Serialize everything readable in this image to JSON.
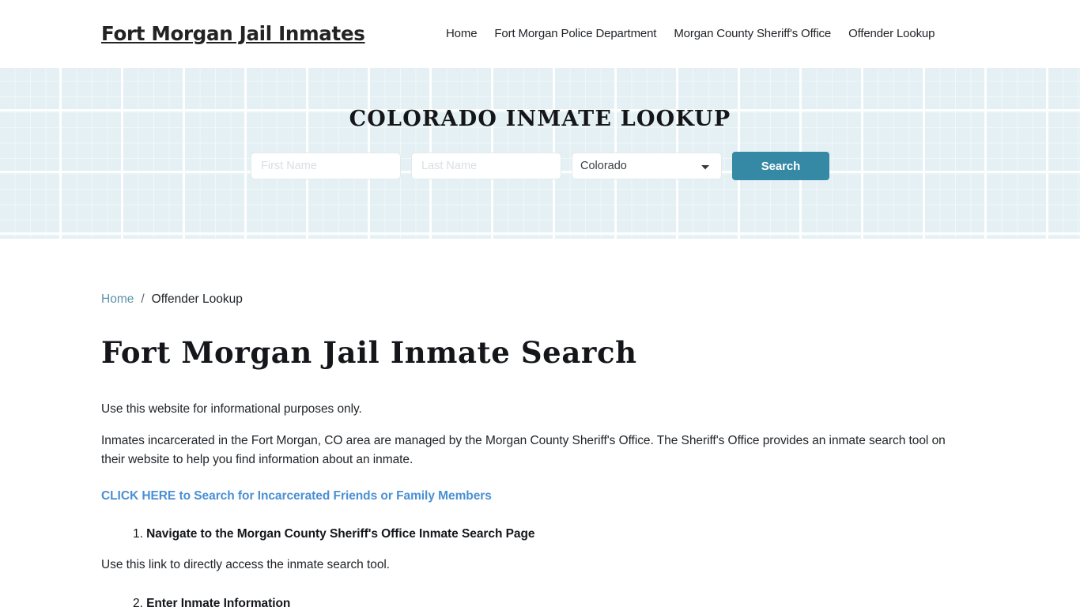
{
  "header": {
    "brand": "Fort Morgan Jail Inmates",
    "nav": [
      {
        "label": "Home"
      },
      {
        "label": "Fort Morgan Police Department"
      },
      {
        "label": "Morgan County Sheriff's Office"
      },
      {
        "label": "Offender Lookup"
      }
    ]
  },
  "hero": {
    "title": "COLORADO INMATE LOOKUP",
    "background_color": "#e4f0f4",
    "form": {
      "first_name_placeholder": "First Name",
      "first_name_value": "",
      "last_name_placeholder": "Last Name",
      "last_name_value": "",
      "state_selected": "Colorado",
      "state_options": [
        "Colorado"
      ],
      "search_label": "Search",
      "search_button_color": "#3689a4"
    }
  },
  "breadcrumb": {
    "home": "Home",
    "separator": "/",
    "current": "Offender Lookup",
    "link_color": "#5b93a8"
  },
  "main": {
    "page_title": "Fort Morgan Jail Inmate Search",
    "intro": "Use this website for informational purposes only.",
    "managed_by": "Inmates incarcerated in the Fort Morgan, CO area are managed by the Morgan County Sheriff's Office. The Sheriff's Office provides an inmate search tool on their website to help you find information about an inmate.",
    "cta_link": "CLICK HERE to Search for Incarcerated Friends or Family Members",
    "cta_color": "#4a8fd4",
    "steps": [
      {
        "number": "1.",
        "label": "Navigate to the Morgan County Sheriff's Office Inmate Search Page"
      },
      {
        "number": "2.",
        "label": "Enter Inmate Information"
      }
    ],
    "use_link_text": "Use this link to directly access the inmate search tool."
  }
}
